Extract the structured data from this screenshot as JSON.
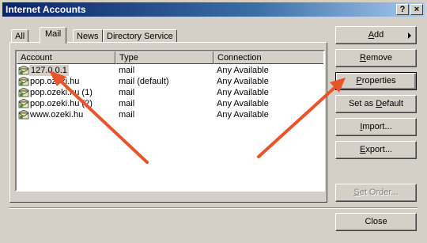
{
  "window": {
    "title": "Internet Accounts",
    "help_glyph": "?",
    "close_glyph": "×"
  },
  "tabs": [
    {
      "label": "All",
      "active": false
    },
    {
      "label": "Mail",
      "active": true
    },
    {
      "label": "News",
      "active": false
    },
    {
      "label": "Directory Service",
      "active": false
    }
  ],
  "list": {
    "columns": [
      "Account",
      "Type",
      "Connection"
    ],
    "rows": [
      {
        "account": "127.0.0.1",
        "type": "mail",
        "connection": "Any Available",
        "selected": true
      },
      {
        "account": "pop.ozeki.hu",
        "type": "mail (default)",
        "connection": "Any Available"
      },
      {
        "account": "pop.ozeki.hu (1)",
        "type": "mail",
        "connection": "Any Available"
      },
      {
        "account": "pop.ozeki.hu (2)",
        "type": "mail",
        "connection": "Any Available"
      },
      {
        "account": "www.ozeki.hu",
        "type": "mail",
        "connection": "Any Available"
      }
    ]
  },
  "buttons": {
    "add": {
      "label": "Add",
      "mnemonic": "A"
    },
    "remove": {
      "label": "Remove",
      "mnemonic": "R"
    },
    "properties": {
      "label": "Properties",
      "mnemonic": "P"
    },
    "set_default": {
      "label": "Set as Default",
      "mnemonic": "D"
    },
    "import": {
      "label": "Import...",
      "mnemonic": "I"
    },
    "export": {
      "label": "Export...",
      "mnemonic": "E"
    },
    "set_order": {
      "label": "Set Order...",
      "mnemonic": "S"
    },
    "close": {
      "label": "Close"
    }
  },
  "annotation": {
    "arrow_color": "#e8552a"
  }
}
